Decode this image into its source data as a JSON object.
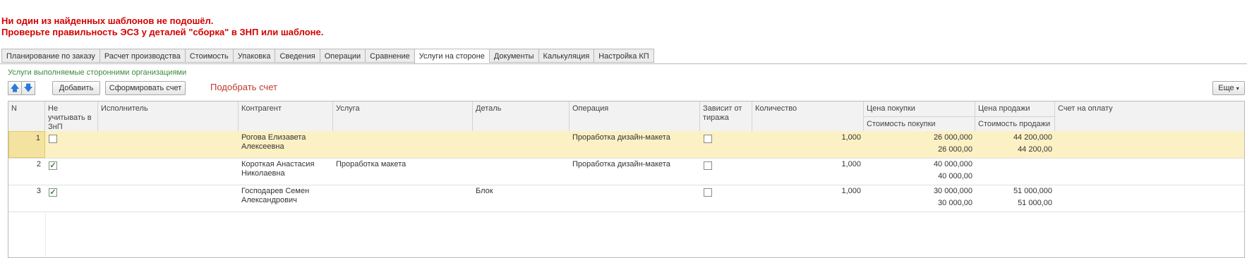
{
  "warnings": {
    "line1": "Ни один из найденных шаблонов не подошёл.",
    "line2": "Проверьте правильность ЭСЗ у деталей \"сборка\" в ЗНП или шаблоне."
  },
  "tabs": [
    {
      "label": "Планирование по заказу",
      "active": false
    },
    {
      "label": "Расчет производства",
      "active": false
    },
    {
      "label": "Стоимость",
      "active": false
    },
    {
      "label": "Упаковка",
      "active": false
    },
    {
      "label": "Сведения",
      "active": false
    },
    {
      "label": "Операции",
      "active": false
    },
    {
      "label": "Сравнение",
      "active": false
    },
    {
      "label": "Услуги на стороне",
      "active": true
    },
    {
      "label": "Документы",
      "active": false
    },
    {
      "label": "Калькуляция",
      "active": false
    },
    {
      "label": "Настройка КП",
      "active": false
    }
  ],
  "section": {
    "caption": "Услуги выполняемые сторонними организациями"
  },
  "toolbar": {
    "up_icon": "arrow-up-icon",
    "down_icon": "arrow-down-icon",
    "add_label": "Добавить",
    "form_label": "Сформировать счет",
    "pick_label": "Подобрать счет",
    "more_label": "Еще",
    "more_icon": "caret-down-icon"
  },
  "table": {
    "headers": {
      "n": "N",
      "exclude": "Не учитывать в ЗнП",
      "executor": "Исполнитель",
      "contractor": "Контрагент",
      "service": "Услуга",
      "detail": "Деталь",
      "operation": "Операция",
      "depends": "Зависит от тиража",
      "quantity": "Количество",
      "buy_price": "Цена покупки",
      "buy_cost": "Стоимость покупки",
      "sell_price": "Цена продажи",
      "sell_cost": "Стоимость продажи",
      "invoice": "Счет на оплату"
    },
    "rows": [
      {
        "n": "1",
        "exclude": false,
        "executor": "",
        "contractor": "Рогова Елизавета Алексеевна",
        "contractor_l1": "Рогова Елизавета",
        "contractor_l2": "Алексеевна",
        "service": "",
        "detail": "",
        "operation": "Проработка дизайн-макета",
        "depends": false,
        "quantity": "1,000",
        "buy_price": "26 000,000",
        "buy_cost": "26 000,00",
        "sell_price": "44 200,000",
        "sell_cost": "44 200,00",
        "invoice": "",
        "selected": true
      },
      {
        "n": "2",
        "exclude": true,
        "executor": "",
        "contractor": "Короткая Анастасия Николаевна",
        "contractor_l1": "Короткая Анастасия",
        "contractor_l2": "Николаевна",
        "service": "Проработка макета",
        "detail": "",
        "operation": "Проработка дизайн-макета",
        "depends": false,
        "quantity": "1,000",
        "buy_price": "40 000,000",
        "buy_cost": "40 000,00",
        "sell_price": "",
        "sell_cost": "",
        "invoice": "",
        "selected": false
      },
      {
        "n": "3",
        "exclude": true,
        "executor": "",
        "contractor": "Господарев Семен Александрович",
        "contractor_l1": "Господарев Семен",
        "contractor_l2": "Александрович",
        "service": "",
        "detail": "Блок",
        "operation": "",
        "depends": false,
        "quantity": "1,000",
        "buy_price": "30 000,000",
        "buy_cost": "30 000,00",
        "sell_price": "51 000,000",
        "sell_cost": "51 000,00",
        "invoice": "",
        "selected": false
      }
    ]
  }
}
